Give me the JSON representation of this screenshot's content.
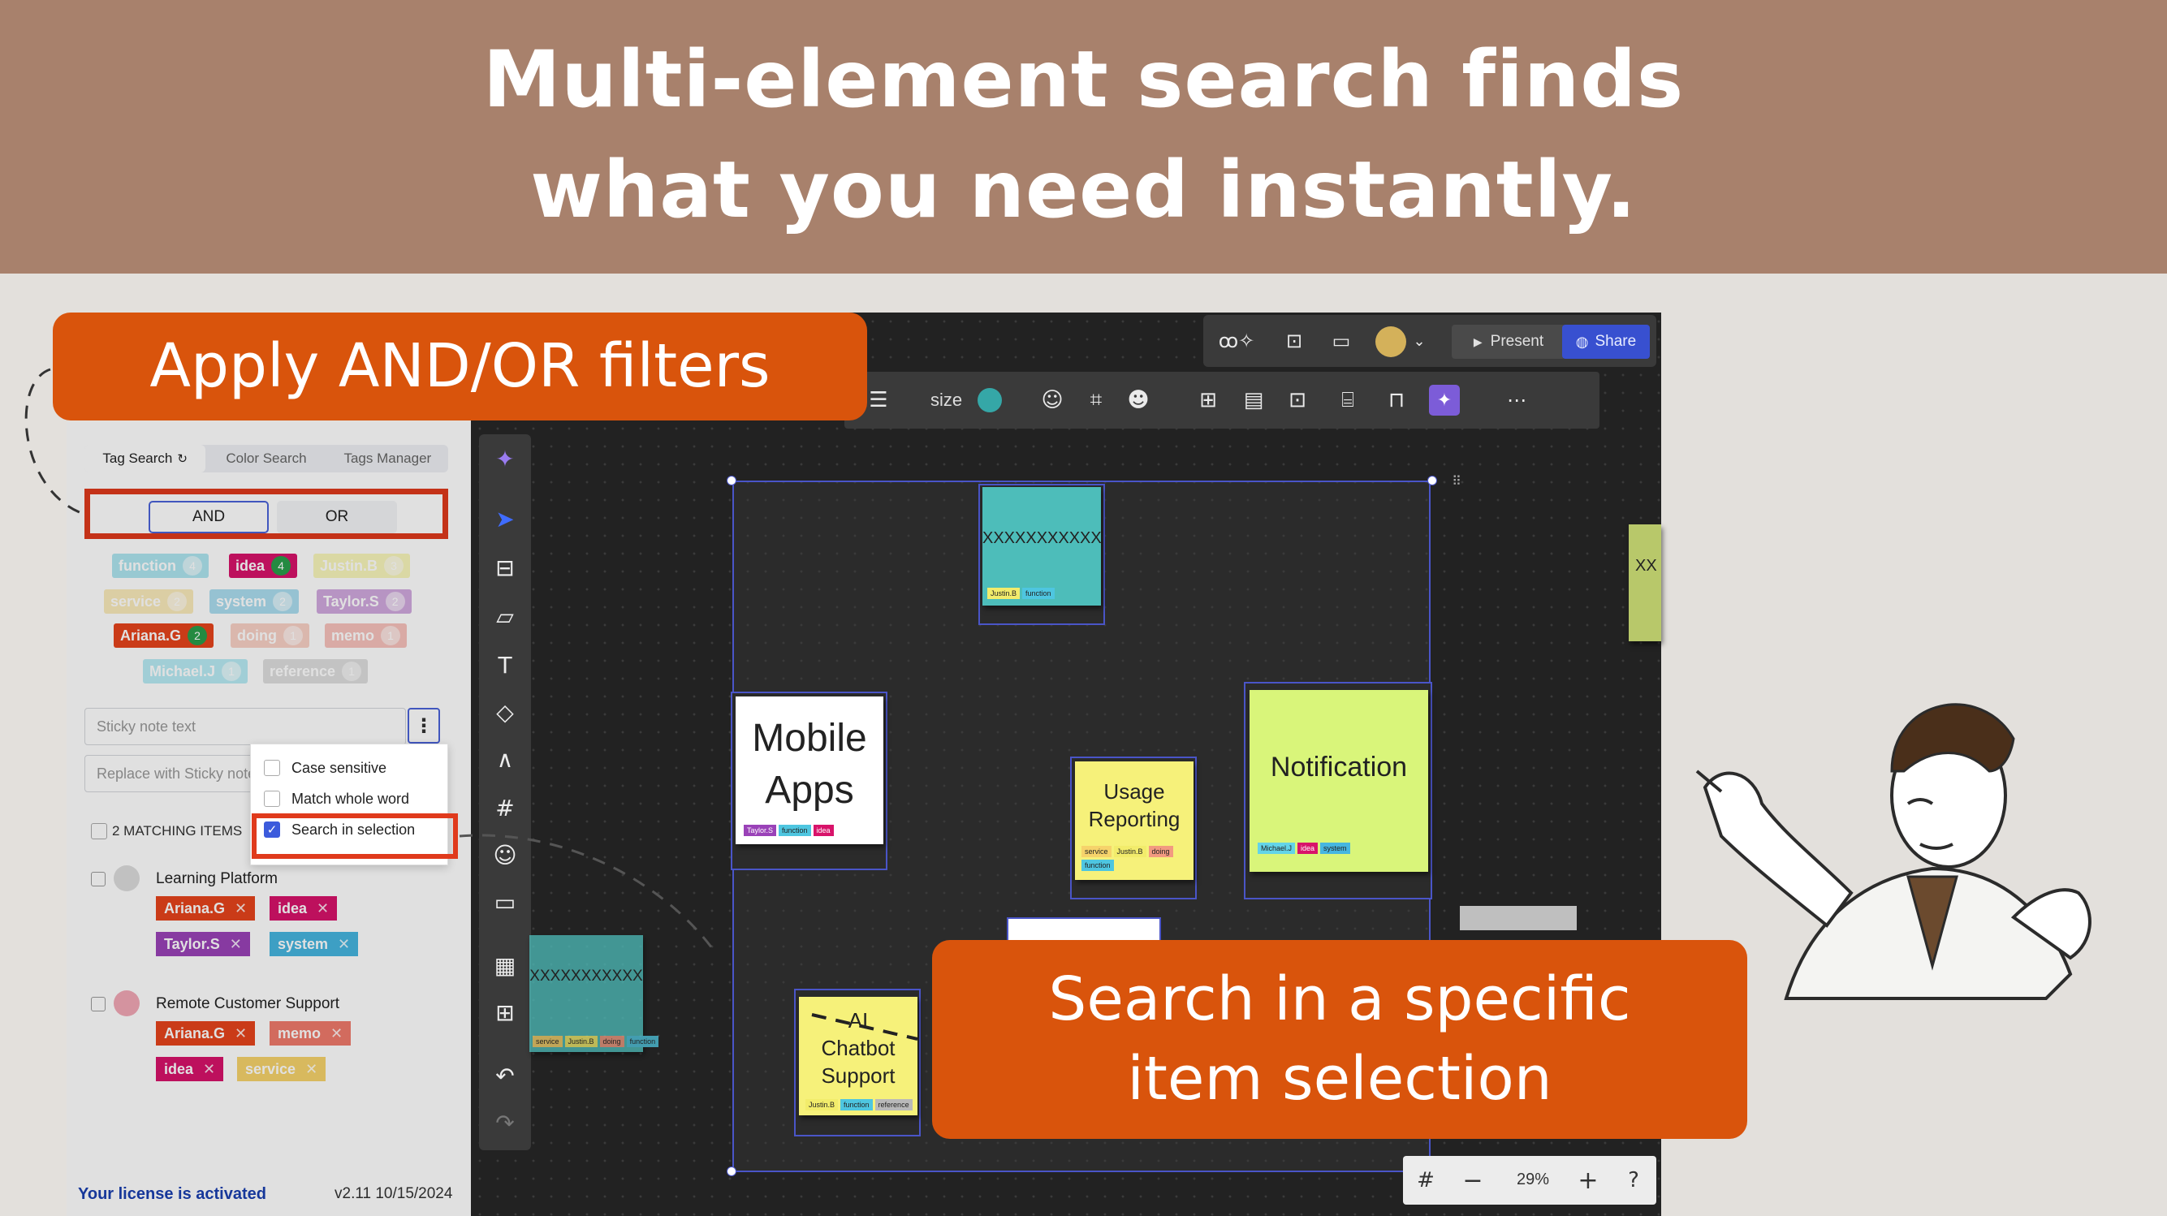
{
  "banner": {
    "line1": "Multi-element search finds",
    "line2": "what you need instantly."
  },
  "callouts": {
    "filters": "Apply AND/OR filters",
    "selection_line1": "Search in a specific",
    "selection_line2": "item selection"
  },
  "panel": {
    "tabs": [
      "Tag Search",
      "Color Search",
      "Tags Manager"
    ],
    "and_label": "AND",
    "or_label": "OR",
    "tags": [
      {
        "label": "function",
        "count": "4",
        "color": "#4ec6e0"
      },
      {
        "label": "idea",
        "count": "4",
        "color": "#d8136a"
      },
      {
        "label": "Justin.B",
        "count": "3",
        "color": "#f2ec6b"
      },
      {
        "label": "service",
        "count": "2",
        "color": "#f6d36b"
      },
      {
        "label": "system",
        "count": "2",
        "color": "#46b6e0"
      },
      {
        "label": "Taylor.S",
        "count": "2",
        "color": "#9a42b8"
      },
      {
        "label": "Ariana.G",
        "count": "2",
        "color": "#e6441c"
      },
      {
        "label": "doing",
        "count": "1",
        "color": "#f29a80"
      },
      {
        "label": "memo",
        "count": "1",
        "color": "#f07a6c"
      },
      {
        "label": "Michael.J",
        "count": "1",
        "color": "#63d4e8"
      },
      {
        "label": "reference",
        "count": "1",
        "color": "#b9b9b9"
      }
    ],
    "search_placeholder": "Sticky note text",
    "replace_placeholder": "Replace with Sticky note text",
    "options": {
      "case_sensitive": "Case sensitive",
      "match_whole_word": "Match whole word",
      "search_in_selection": "Search in selection"
    },
    "matching": "2 MATCHING ITEMS",
    "results": [
      {
        "title": "Learning Platform",
        "tags": [
          "Ariana.G",
          "idea",
          "Taylor.S",
          "system"
        ]
      },
      {
        "title": "Remote Customer Support",
        "tags": [
          "Ariana.G",
          "memo",
          "idea",
          "service"
        ]
      }
    ],
    "license": "Your license is activated",
    "version": "v2.11 10/15/2024"
  },
  "toolbar": {
    "present": "Present",
    "share": "Share",
    "size_label": "size"
  },
  "canvas": {
    "notes": [
      {
        "text": "XXXXXXXXXXX",
        "tags": [
          "Justin.B",
          "function"
        ]
      },
      {
        "text": "Mobile Apps",
        "tags": [
          "Taylor.S",
          "function",
          "idea"
        ]
      },
      {
        "text": "Usage Reporting",
        "tags": [
          "service",
          "Justin.B",
          "doing",
          "function"
        ]
      },
      {
        "text": "Notification",
        "tags": [
          "Michael.J",
          "idea",
          "system"
        ]
      },
      {
        "text": "AI Chatbot Support",
        "tags": [
          "Justin.B",
          "function",
          "reference"
        ]
      },
      {
        "text": "XXXXXXXXXXX",
        "tags": [
          "service",
          "Justin.B",
          "doing",
          "function"
        ]
      },
      {
        "text": "XX",
        "tags": []
      }
    ]
  },
  "zoom": {
    "level": "29%"
  },
  "colors": {
    "accent": "#d9540c",
    "highlight": "#e03a1c",
    "banner": "#a8816c",
    "selection": "#4a55c8"
  }
}
